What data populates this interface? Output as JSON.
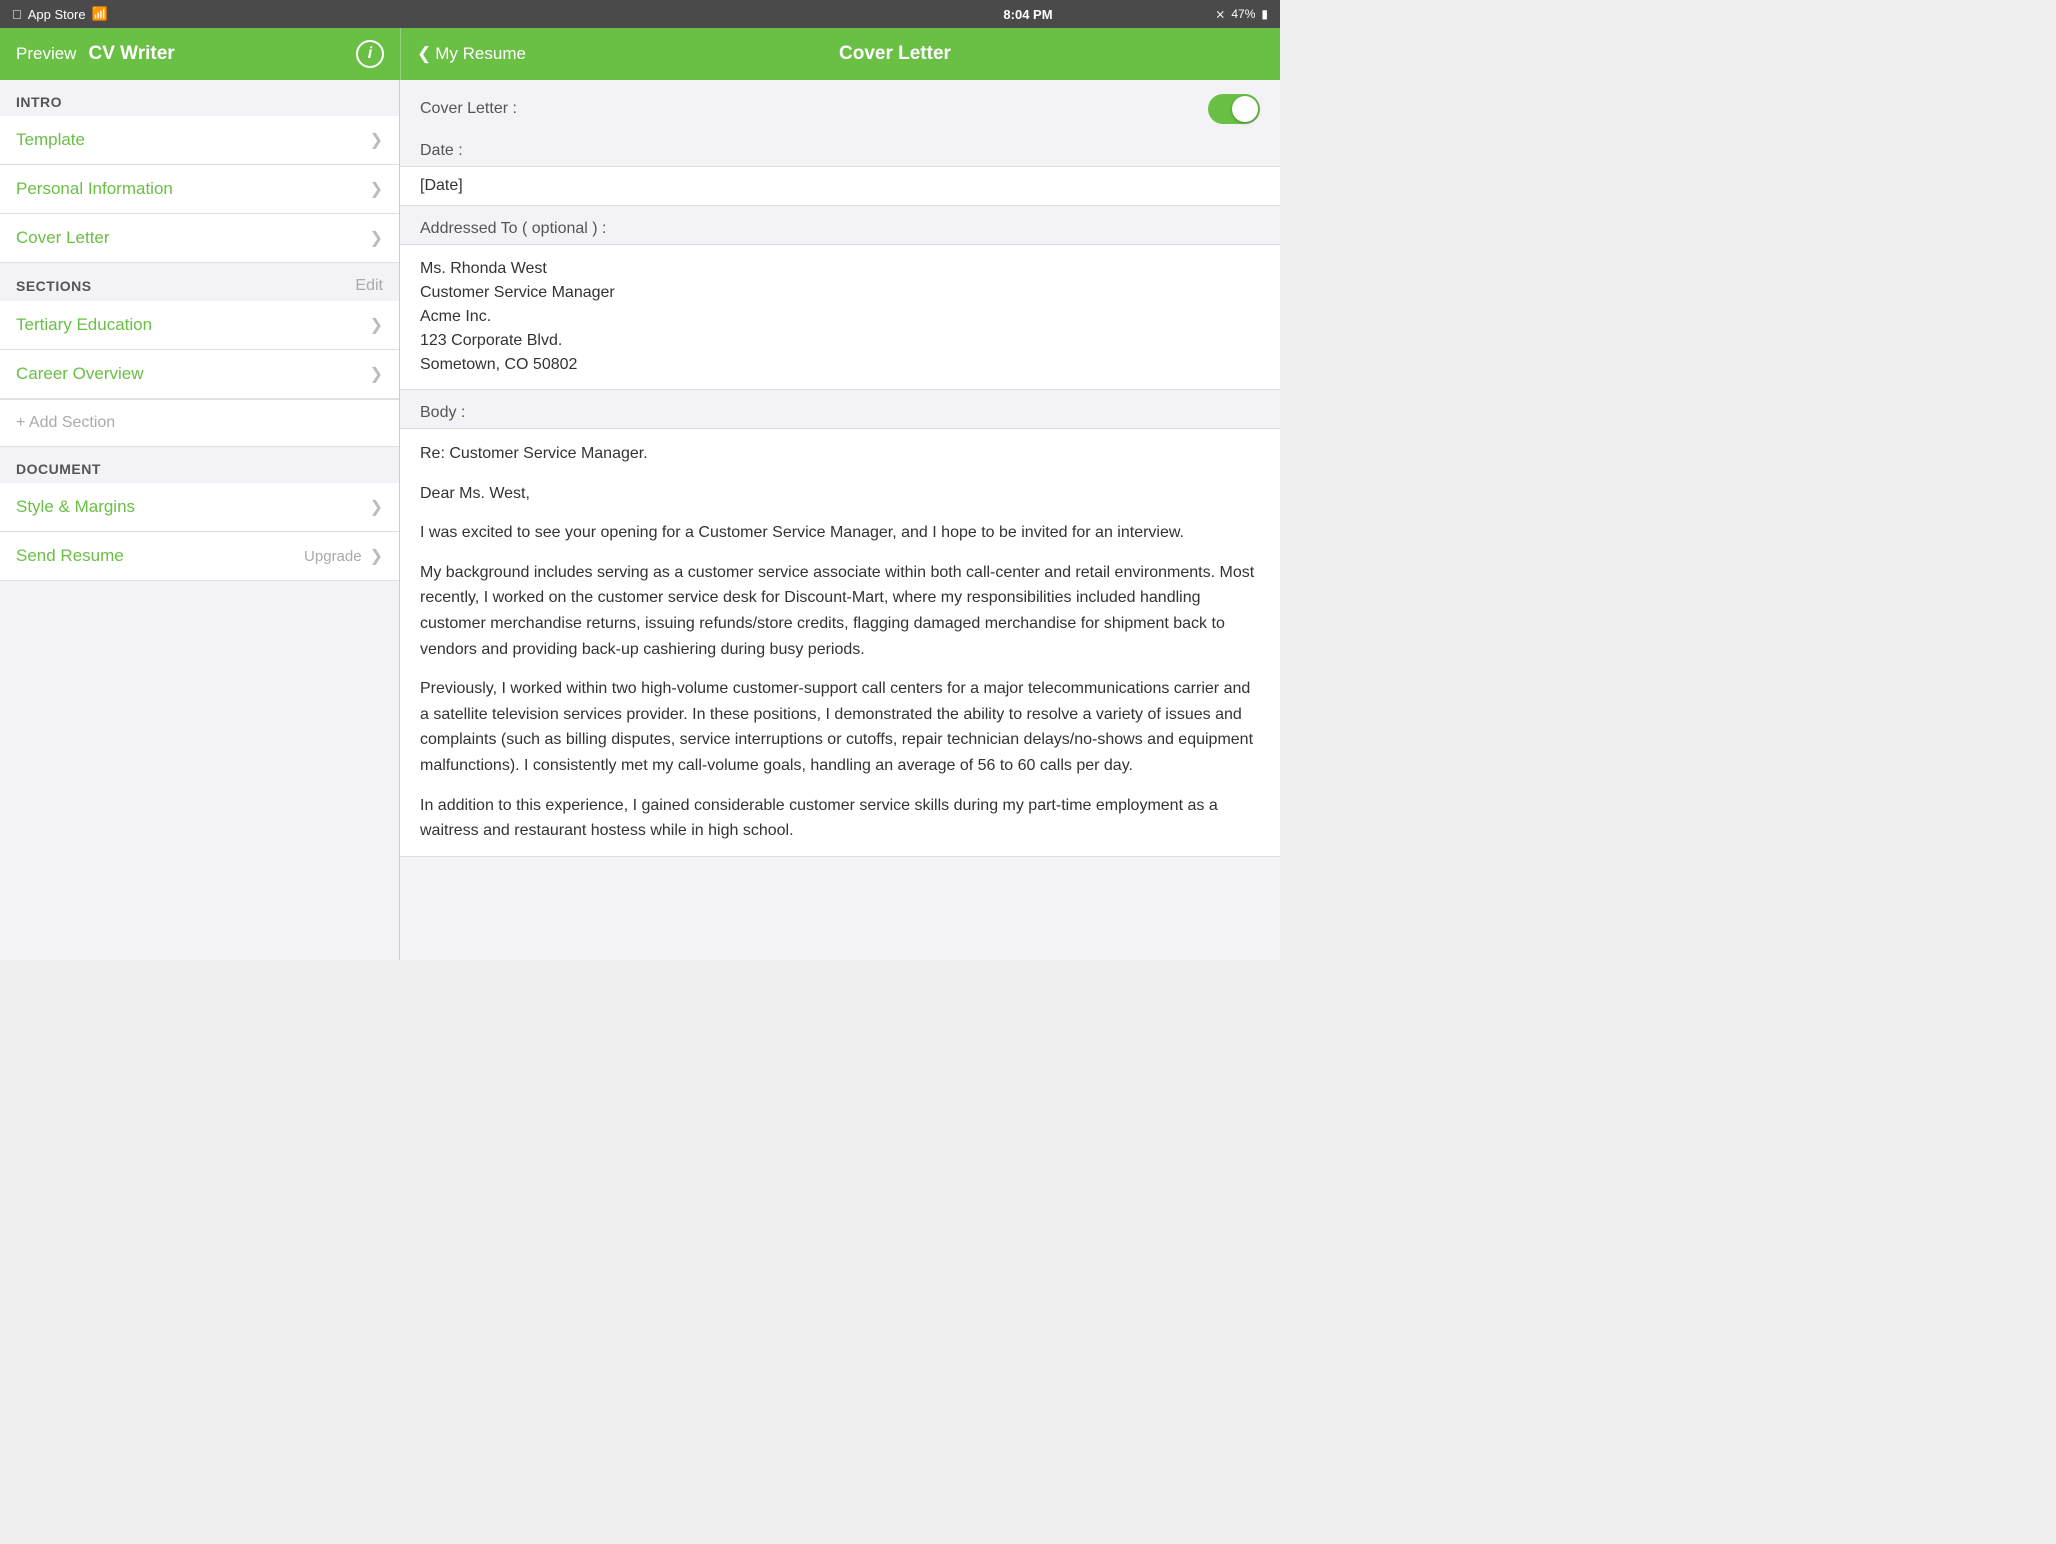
{
  "statusBar": {
    "left": "App Store",
    "signal": "wifi",
    "time": "8:04 PM",
    "bluetooth": "BT",
    "battery": "47%"
  },
  "navLeft": {
    "preview": "Preview",
    "title": "CV Writer",
    "info": "i"
  },
  "navRight": {
    "backLabel": "My Resume",
    "title": "Cover Letter"
  },
  "sidebar": {
    "introHeader": "Intro",
    "items": [
      {
        "label": "Template"
      },
      {
        "label": "Personal Information"
      },
      {
        "label": "Cover Letter"
      }
    ],
    "sectionsHeader": "Sections",
    "sectionsEdit": "Edit",
    "sectionItems": [
      {
        "label": "Tertiary Education"
      },
      {
        "label": "Career Overview"
      }
    ],
    "addSection": "+ Add Section",
    "documentHeader": "Document",
    "documentItems": [
      {
        "label": "Style & Margins"
      },
      {
        "label": "Send Resume",
        "badge": "Upgrade"
      }
    ]
  },
  "content": {
    "coverLetterLabel": "Cover Letter :",
    "toggleEnabled": true,
    "dateLabel": "Date :",
    "dateValue": "[Date]",
    "addressedToLabel": "Addressed To ( optional ) :",
    "addressedTo": "Ms. Rhonda West\nCustomer Service Manager\nAcme Inc.\n123 Corporate Blvd.\nSometown, CO 50802",
    "bodyLabel": "Body :",
    "bodyParagraphs": [
      "Re: Customer Service Manager.",
      "Dear Ms. West,",
      "I was excited to see your opening for a Customer Service Manager, and I hope to be invited for an interview.",
      "My background includes serving as a customer service associate within both call-center and retail environments. Most recently, I worked on the customer service desk for Discount-Mart, where my responsibilities included handling customer merchandise returns, issuing refunds/store credits, flagging damaged merchandise for shipment back to vendors and providing back-up cashiering during busy periods.",
      "Previously, I worked within two high-volume customer-support call centers for a major telecommunications carrier and a satellite television services provider. In these positions, I demonstrated the ability to resolve a variety of issues and complaints (such as billing disputes, service interruptions or cutoffs, repair technician delays/no-shows and equipment malfunctions). I consistently met my call-volume goals, handling an average of 56 to 60 calls per day.",
      "In addition to this experience, I gained considerable customer service skills during my part-time employment as a waitress and restaurant hostess while in high school."
    ]
  }
}
